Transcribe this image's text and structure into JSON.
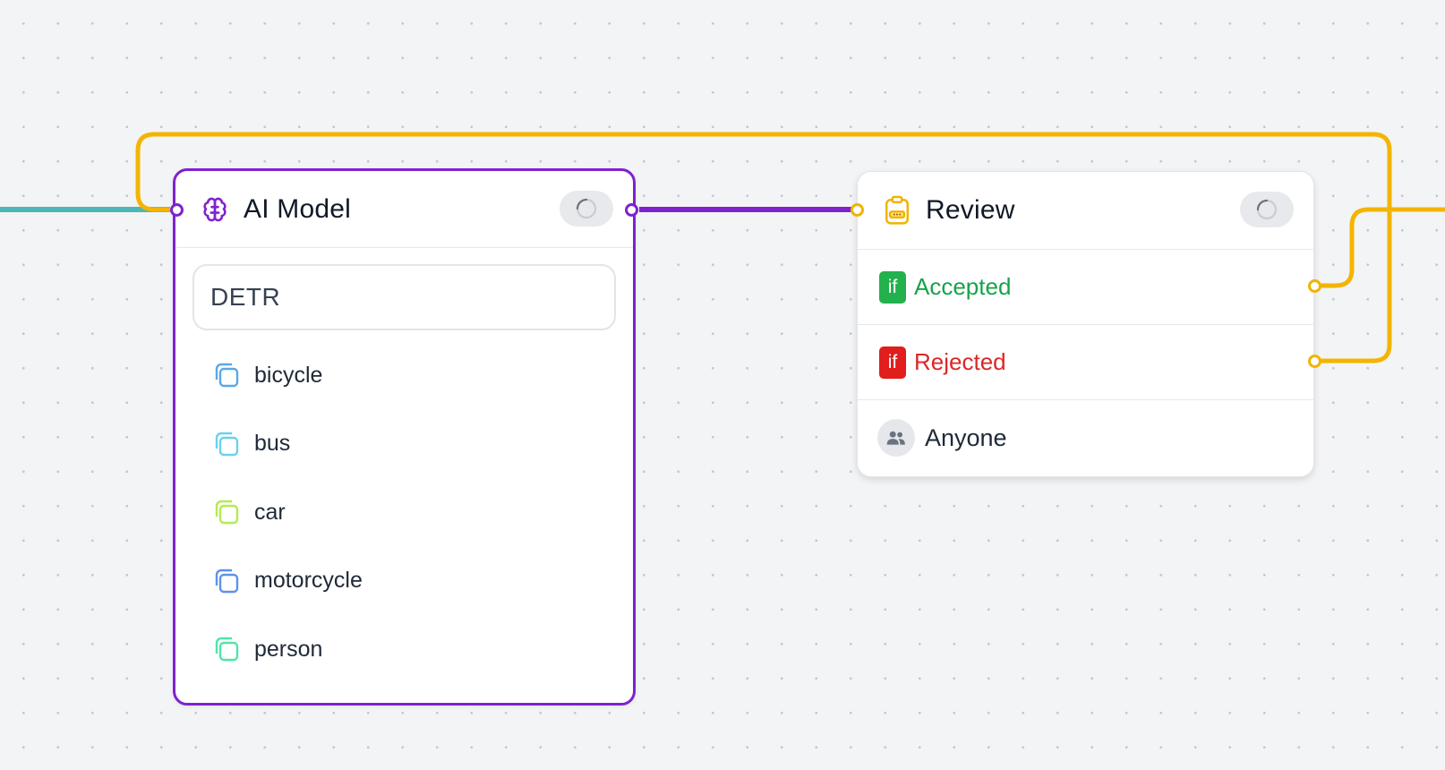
{
  "colors": {
    "ai_accent": "#7e22ce",
    "review_accent": "#f0b400",
    "incoming_edge": "#4db6b8",
    "accepted": "#16a34a",
    "accepted_badge": "#22b14c",
    "rejected": "#dc2626",
    "rejected_badge": "#e11d1d"
  },
  "ai_node": {
    "title": "AI Model",
    "icon": "brain-icon",
    "status_icon": "spinner-icon",
    "model": "DETR",
    "classes": [
      {
        "label": "bicycle",
        "icon": "class-icon",
        "color": "#5aa7ea"
      },
      {
        "label": "bus",
        "icon": "class-icon",
        "color": "#6ad2ea"
      },
      {
        "label": "car",
        "icon": "class-icon",
        "color": "#b3ec4f"
      },
      {
        "label": "motorcycle",
        "icon": "class-icon",
        "color": "#5b93e8"
      },
      {
        "label": "person",
        "icon": "class-icon",
        "color": "#4ee6a6"
      }
    ]
  },
  "review_node": {
    "title": "Review",
    "icon": "clipboard-icon",
    "status_icon": "spinner-icon",
    "outcomes": [
      {
        "badge": "if",
        "label": "Accepted"
      },
      {
        "badge": "if",
        "label": "Rejected"
      }
    ],
    "assignee": {
      "icon": "users-icon",
      "label": "Anyone"
    }
  }
}
